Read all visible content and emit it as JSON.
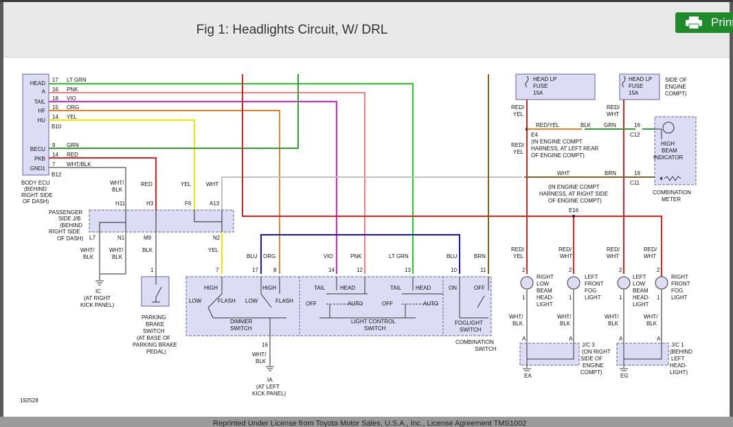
{
  "header": {
    "title": "Fig 1: Headlights Circuit, W/ DRL",
    "print_label": "Print"
  },
  "footer": {
    "text": "Reprinted Under License from Toyota Motor Sales, U.S.A., Inc., License Agreement TMS1002"
  },
  "colors": {
    "lt_grn": "#22cc22",
    "pnk": "#f08080",
    "vio": "#e020e0",
    "org": "#f08020",
    "yel": "#e8e800",
    "grn": "#30a030",
    "red": "#e02020",
    "wht": "#c0c0c0",
    "blu": "#1010e0",
    "brn": "#806020",
    "wht_blk": "#909090",
    "box_fill": "#dcdcf5",
    "button_green": "#1f8a2a"
  },
  "diagram": {
    "id": "192528",
    "body_ecu": {
      "pins": [
        {
          "label": "HEAD",
          "num": "17",
          "wire": "LT GRN"
        },
        {
          "label": "A",
          "num": "16",
          "wire": "PNK"
        },
        {
          "label": "TAIL",
          "num": "18",
          "wire": "VIO"
        },
        {
          "label": "HF",
          "num": "15",
          "wire": "ORG"
        },
        {
          "label": "HU",
          "num": "14",
          "wire": "YEL"
        },
        {
          "label": "BECU",
          "num": "9",
          "wire": "GRN"
        },
        {
          "label": "PKB",
          "num": "14",
          "wire": "RED"
        },
        {
          "label": "GND1",
          "num": "7",
          "wire": "WHT/BLK"
        }
      ],
      "conn1": "B10",
      "conn2": "B12",
      "name": [
        "BODY ECU",
        "(BEHIND",
        "RIGHT SIDE",
        "OF DASH)"
      ]
    },
    "pj": {
      "name": [
        "PASSENGER",
        "SIDE J/B",
        "(BEHIND",
        "RIGHT SIDE",
        "OF DASH)"
      ],
      "top": [
        {
          "wire": "WHT/",
          "wire2": "BLK",
          "term": "H11"
        },
        {
          "wire": "RED",
          "term": "H3"
        },
        {
          "wire": "YEL",
          "term": "F6"
        },
        {
          "wire": "WHT",
          "term": "A13"
        }
      ],
      "bottom": [
        {
          "term": "L7",
          "wire": "WHT/",
          "wire2": "BLK"
        },
        {
          "term": "N1",
          "wire": "WHT/",
          "wire2": "BLK"
        },
        {
          "term": "M9",
          "wire": "BLK"
        },
        {
          "term": "N2",
          "wire": "YEL"
        }
      ]
    },
    "ground_ic": [
      "IC",
      "(AT RIGHT",
      "KICK PANEL)"
    ],
    "parking_brake": {
      "pin": "1",
      "name": [
        "PARKING",
        "BRAKE",
        "SWITCH",
        "(AT BASE OF",
        "PARKING BRAKE",
        "PEDAL)"
      ]
    },
    "combo_switch": {
      "pins": [
        {
          "num": "7",
          "wire": ""
        },
        {
          "num": "17",
          "wire": "BLU"
        },
        {
          "num": "8",
          "wire": "ORG"
        },
        {
          "num": "14",
          "wire": "VIO"
        },
        {
          "num": "12",
          "wire": "PNK"
        },
        {
          "num": "13",
          "wire": "LT GRN"
        },
        {
          "num": "10",
          "wire": "BLU"
        },
        {
          "num": "11",
          "wire": "BRN"
        }
      ],
      "dimmer": {
        "high": "HIGH",
        "flash": "FLASH",
        "low": "LOW",
        "high2": "HIGH",
        "low2": "LOW",
        "flash2": "FLASH",
        "name": [
          "DIMMER",
          "SWITCH"
        ]
      },
      "light_control": {
        "tail": "TAIL",
        "head": "HEAD",
        "off": "OFF",
        "auto": "AUTO",
        "name": "LIGHT CONTROL",
        "name2": "SWITCH"
      },
      "foglight": {
        "on": "ON",
        "off": "OFF",
        "name": [
          "FOGLIGHT",
          "SWITCH"
        ]
      },
      "name": [
        "COMBINATION",
        "SWITCH"
      ],
      "bottom_pin": "16",
      "bottom_wire": [
        "WHT/",
        "BLK"
      ]
    },
    "ground_ia": [
      "IA",
      "(AT LEFT",
      "KICK PANEL)"
    ],
    "fuses": [
      {
        "name": [
          "HEAD LP",
          "FUSE",
          "15A"
        ]
      },
      {
        "name": [
          "HEAD LP",
          "FUSE",
          "15A"
        ]
      }
    ],
    "engine_compt_side": [
      "SIDE OF",
      "ENGINE",
      "COMPT)"
    ],
    "e4": {
      "term": "E4",
      "wire": "RED/YEL",
      "wire_blk": "BLK",
      "wire_grn": "GRN",
      "pin": "16",
      "conn": "C12",
      "desc": [
        "(IN ENGINE COMPT",
        "HARNESS, AT LEFT REAR",
        "OF ENGINE COMPT)"
      ]
    },
    "e16": {
      "wire_wht": "WHT",
      "wire_brn": "BRN",
      "pin": "19",
      "conn": "C11",
      "term": "E16",
      "desc": [
        "(IN ENGINE COMPT",
        "HARNESS, AT RIGHT SIDE",
        "OF ENGINE COMPT)"
      ]
    },
    "wire_red_yel": [
      "RED/",
      "YEL"
    ],
    "wire_red_wht": [
      "RED/",
      "WHT"
    ],
    "high_beam": {
      "name": [
        "HIGH",
        "BEAM",
        "INDICATOR"
      ]
    },
    "combination_meter": [
      "COMBINATION",
      "METER"
    ],
    "loads": [
      {
        "wire1": "RED/",
        "wire1b": "YEL",
        "p2": "2",
        "p1": "1",
        "name": [
          "RIGHT",
          "LOW",
          "BEAM",
          "HEAD-",
          "LIGHT"
        ],
        "wire2": "WHT/",
        "wire2b": "BLK"
      },
      {
        "wire1": "RED/",
        "wire1b": "WHT",
        "p2": "2",
        "p1": "1",
        "name": [
          "LEFT",
          "FRONT",
          "FOG",
          "LIGHT"
        ],
        "wire2": "WHT/",
        "wire2b": "BLK"
      },
      {
        "wire1": "RED/",
        "wire1b": "WHT",
        "p2": "2",
        "p1": "1",
        "name": [
          "LEFT",
          "LOW",
          "BEAM",
          "HEAD-",
          "LIGHT"
        ],
        "wire2": "WHT/",
        "wire2b": "BLK"
      },
      {
        "wire1": "RED/",
        "wire1b": "WHT",
        "p2": "2",
        "p1": "1",
        "name": [
          "RIGHT",
          "FRONT",
          "FOG",
          "LIGHT"
        ],
        "wire2": "WHT/",
        "wire2b": "BLK"
      }
    ],
    "jc3": {
      "name": [
        "J/C 3",
        "(ON RIGHT",
        "SIDE OF",
        "ENGINE",
        "COMPT)"
      ],
      "pin": "A",
      "ground": "EA"
    },
    "jc1": {
      "name": [
        "J/C 1",
        "(BEHIND",
        "LEFT",
        "HEAD-",
        "LIGHT)"
      ],
      "pin": "A",
      "ground": "EG"
    }
  }
}
